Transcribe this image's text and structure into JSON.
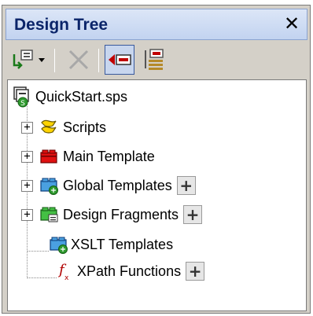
{
  "panel": {
    "title": "Design Tree",
    "close_glyph": "✕"
  },
  "toolbar": {
    "buttons": [
      {
        "icon": "add-design-item-icon"
      },
      {
        "icon": "delete-icon"
      },
      {
        "icon": "move-left-icon",
        "pressed": true
      },
      {
        "icon": "show-all-items-icon"
      }
    ]
  },
  "tree": {
    "root": {
      "label": "QuickStart.sps",
      "icon": "sps-file-icon"
    },
    "items": [
      {
        "label": "Scripts",
        "icon": "scripts-icon",
        "expander": "+",
        "add_button": false
      },
      {
        "label": "Main Template",
        "icon": "main-template-icon",
        "expander": "+",
        "add_button": false
      },
      {
        "label": "Global Templates",
        "icon": "global-templates-icon",
        "expander": "+",
        "add_button": true
      },
      {
        "label": "Design Fragments",
        "icon": "design-fragments-icon",
        "expander": "+",
        "add_button": true
      },
      {
        "label": "XSLT Templates",
        "icon": "xslt-templates-icon",
        "expander": "",
        "add_button": false
      },
      {
        "label": "XPath Functions",
        "icon": "xpath-functions-icon",
        "expander": "",
        "add_button": true
      }
    ],
    "add_glyph": "+"
  }
}
